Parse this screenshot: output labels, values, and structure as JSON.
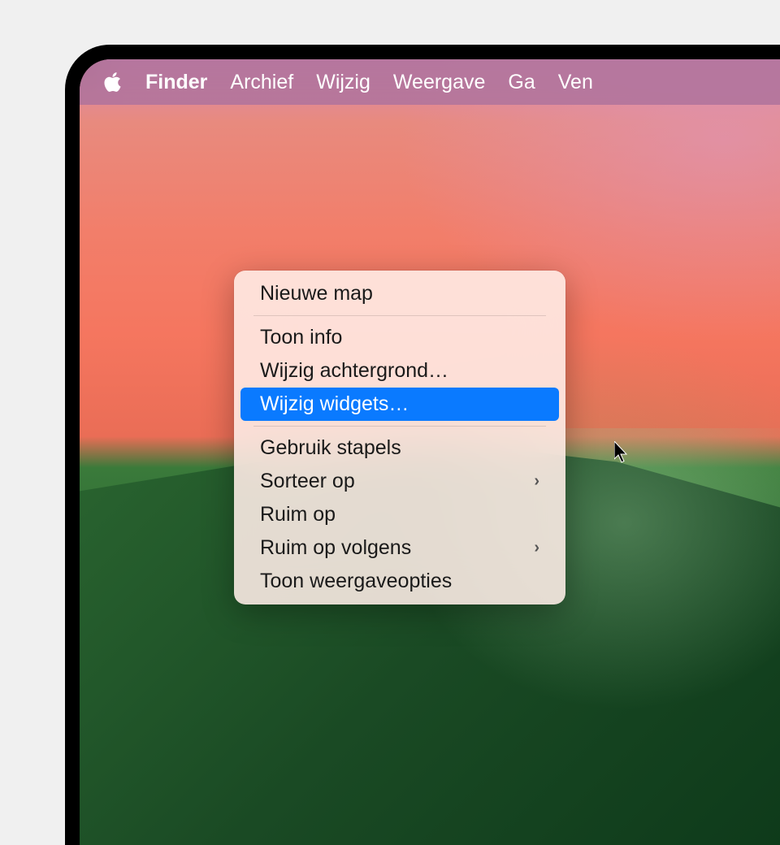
{
  "menubar": {
    "items": [
      {
        "label": "Finder",
        "bold": true
      },
      {
        "label": "Archief",
        "bold": false
      },
      {
        "label": "Wijzig",
        "bold": false
      },
      {
        "label": "Weergave",
        "bold": false
      },
      {
        "label": "Ga",
        "bold": false
      },
      {
        "label": "Ven",
        "bold": false
      }
    ]
  },
  "context_menu": {
    "groups": [
      [
        {
          "label": "Nieuwe map",
          "submenu": false,
          "selected": false
        }
      ],
      [
        {
          "label": "Toon info",
          "submenu": false,
          "selected": false
        },
        {
          "label": "Wijzig achtergrond…",
          "submenu": false,
          "selected": false
        },
        {
          "label": "Wijzig widgets…",
          "submenu": false,
          "selected": true
        }
      ],
      [
        {
          "label": "Gebruik stapels",
          "submenu": false,
          "selected": false
        },
        {
          "label": "Sorteer op",
          "submenu": true,
          "selected": false
        },
        {
          "label": "Ruim op",
          "submenu": false,
          "selected": false
        },
        {
          "label": "Ruim op volgens",
          "submenu": true,
          "selected": false
        },
        {
          "label": "Toon weergaveopties",
          "submenu": false,
          "selected": false
        }
      ]
    ]
  }
}
